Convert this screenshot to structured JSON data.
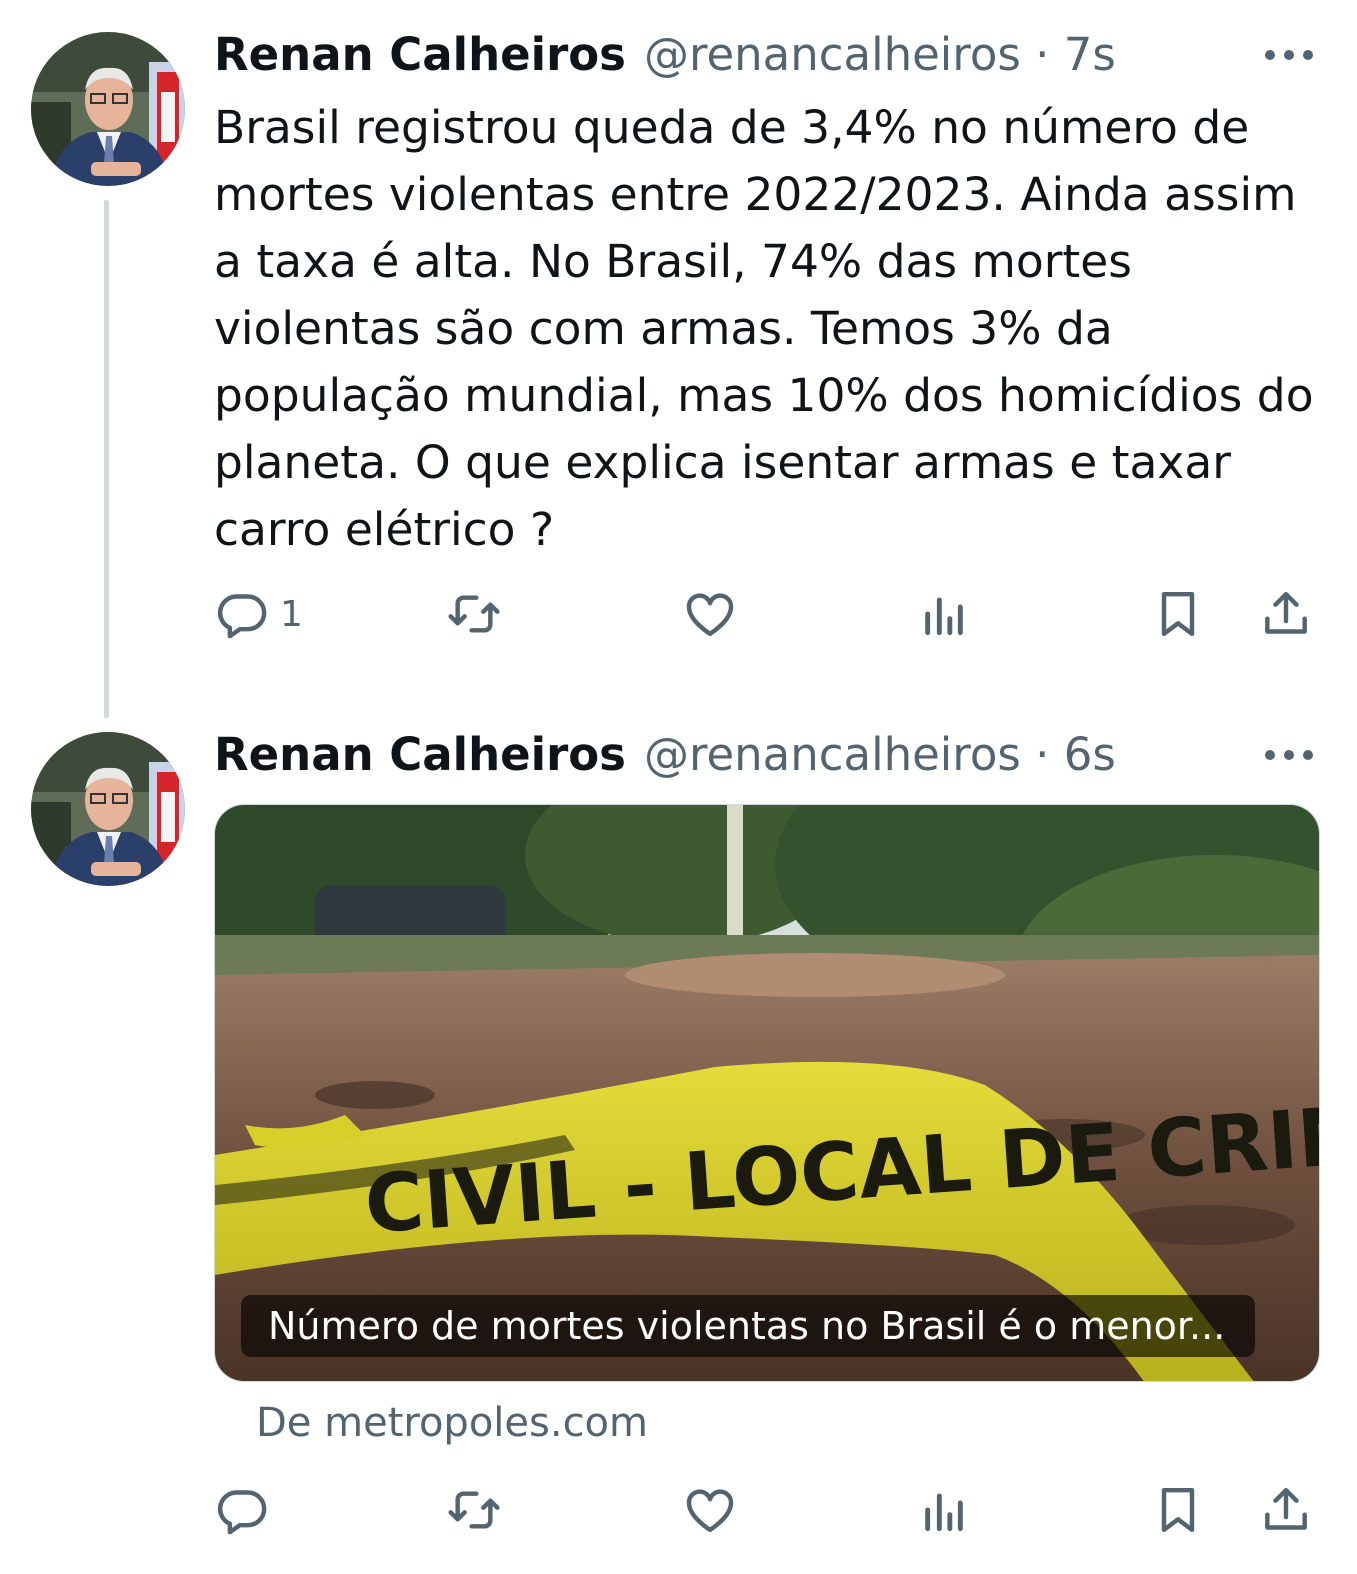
{
  "tweets": [
    {
      "author_name": "Renan Calheiros",
      "handle_time": "@renancalheiros · 7s",
      "text": "Brasil registrou queda de 3,4% no número de mortes violentas entre 2022/2023. Ainda assim a taxa é alta. No Brasil, 74% das mortes violentas são com armas. Temos 3% da população mundial, mas 10% dos homicídios do planeta. O que explica isentar armas e taxar carro elétrico ?",
      "reply_count": "1"
    },
    {
      "author_name": "Renan Calheiros",
      "handle_time": "@renancalheiros · 6s",
      "card": {
        "image_alt": "Fita amarela de isolamento de cena de crime em estrada de terra",
        "tape_text": "CIVIL - LOCAL DE CRIME - NÃO",
        "caption": "Número de mortes violentas no Brasil é o menor...",
        "source": "De metropoles.com"
      }
    }
  ],
  "icons": [
    "more-icon",
    "reply-icon",
    "retweet-icon",
    "like-icon",
    "views-icon",
    "bookmark-icon",
    "share-icon"
  ],
  "colors": {
    "text": "#0f1419",
    "secondary": "#536471",
    "thread_line": "#cfd9de",
    "tape": "#d8d11e"
  }
}
